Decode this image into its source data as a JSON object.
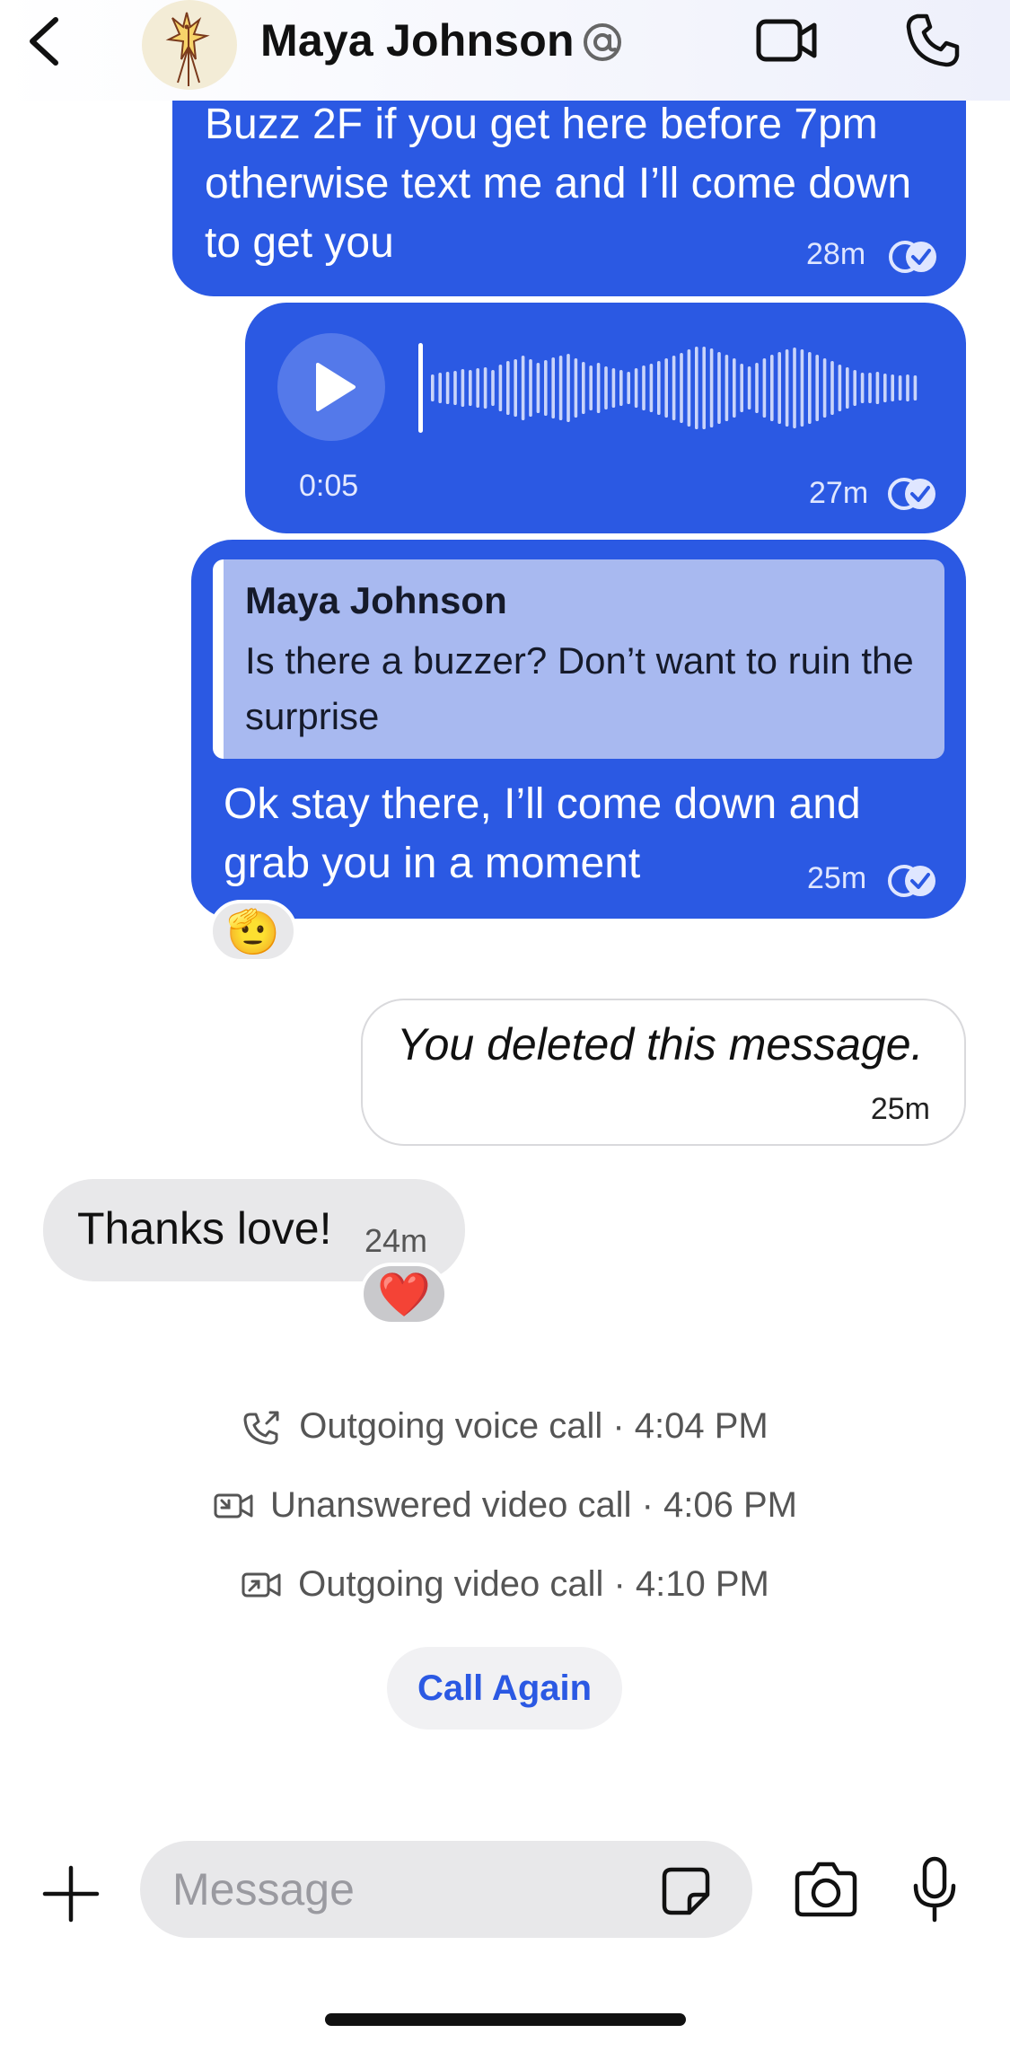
{
  "header": {
    "contact_name": "Maya Johnson",
    "back_icon": "chevron-left-icon",
    "handle_icon": "at-sign-icon",
    "video_icon": "video-camera-icon",
    "call_icon": "phone-icon"
  },
  "messages": {
    "m1": {
      "text": "Buzz 2F if you get here before 7pm otherwise text me and I’ll come down to get you",
      "time": "28m"
    },
    "voice": {
      "duration": "0:05",
      "time": "27m"
    },
    "reply": {
      "quoted_name": "Maya Johnson",
      "quoted_text": "Is there a buzzer? Don’t want to ruin the surprise",
      "text": "Ok stay there, I’ll come down and grab you in a moment",
      "time": "25m",
      "reaction": "🫡"
    },
    "deleted": {
      "text": "You deleted this message.",
      "time": "25m"
    },
    "incoming": {
      "text": "Thanks love!",
      "time": "24m",
      "reaction": "❤️"
    }
  },
  "call_log": [
    {
      "icon": "outgoing-call-icon",
      "text": "Outgoing voice call · 4:04 PM"
    },
    {
      "icon": "video-missed-icon",
      "text": "Unanswered video call · 4:06 PM"
    },
    {
      "icon": "video-outgoing-icon",
      "text": "Outgoing video call · 4:10 PM"
    }
  ],
  "call_again_label": "Call Again",
  "composer": {
    "placeholder": "Message",
    "value": ""
  },
  "colors": {
    "accent": "#2b59e3",
    "quote_bg": "#a8b9f0",
    "incoming_bg": "#e8e8ea"
  }
}
